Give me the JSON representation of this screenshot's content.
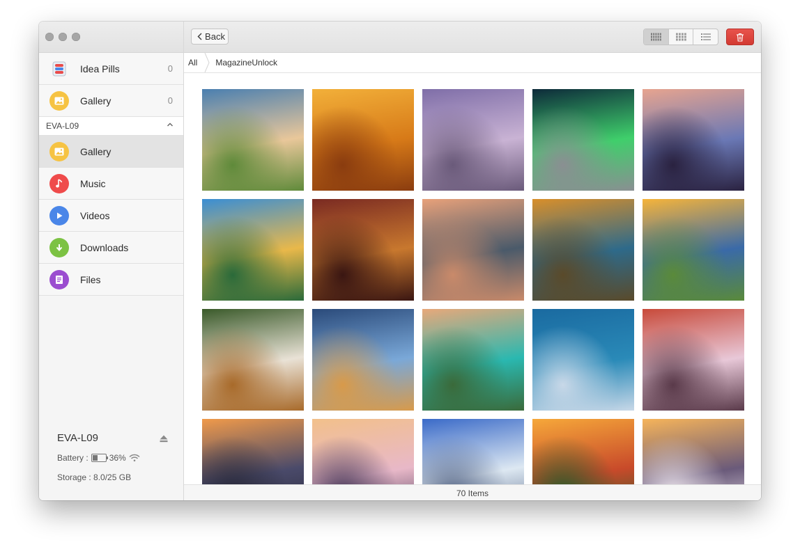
{
  "window": {
    "traffic_lights": [
      "close",
      "minimize",
      "zoom"
    ]
  },
  "sidebar": {
    "top_items": [
      {
        "label": "Idea Pills",
        "count": "0",
        "icon": "idea-pills-icon",
        "color": "#4a86e8"
      },
      {
        "label": "Gallery",
        "count": "0",
        "icon": "gallery-icon",
        "color": "#f6c343"
      }
    ],
    "device_header": "EVA-L09",
    "device_items": [
      {
        "label": "Gallery",
        "icon": "gallery-icon",
        "color": "#f6c343",
        "selected": true
      },
      {
        "label": "Music",
        "icon": "music-icon",
        "color": "#ef4b4b"
      },
      {
        "label": "Videos",
        "icon": "play-icon",
        "color": "#4a86e8"
      },
      {
        "label": "Downloads",
        "icon": "download-icon",
        "color": "#7cc243"
      },
      {
        "label": "Files",
        "icon": "file-icon",
        "color": "#9b4dd0"
      }
    ],
    "device_info": {
      "name": "EVA-L09",
      "battery_label": "Battery :",
      "battery_percent": "36%",
      "battery_level": 0.36,
      "storage": "Storage : 8.0/25 GB"
    }
  },
  "toolbar": {
    "back_label": "Back",
    "view_modes": [
      "large-grid",
      "medium-grid",
      "list"
    ],
    "active_view": "large-grid",
    "delete_color": "#e0453e"
  },
  "breadcrumb": {
    "items": [
      "All",
      "MagazineUnlock"
    ]
  },
  "gallery": {
    "thumbnails": [
      {
        "name": "coast-beach",
        "colors": [
          "#4a7fb0",
          "#e9c79a",
          "#5f8a3a"
        ]
      },
      {
        "name": "desert-dune",
        "colors": [
          "#f2b03a",
          "#d77a18",
          "#8a3c0f"
        ]
      },
      {
        "name": "misty-rocks",
        "colors": [
          "#7f6ea8",
          "#c9b3d4",
          "#6a5a7a"
        ]
      },
      {
        "name": "aurora-mountain",
        "colors": [
          "#0d2a3a",
          "#3fcf6b",
          "#8a8f92"
        ]
      },
      {
        "name": "bridge-sunset",
        "colors": [
          "#e7a48f",
          "#6a78b5",
          "#2a2240"
        ]
      },
      {
        "name": "autumn-lake",
        "colors": [
          "#3a8ed4",
          "#e9b84a",
          "#2a6a3a"
        ]
      },
      {
        "name": "cathedral-ceiling",
        "colors": [
          "#7a2a22",
          "#c8782e",
          "#3a1612"
        ]
      },
      {
        "name": "lake-church",
        "colors": [
          "#e8a17a",
          "#4a5a6a",
          "#c98a6a"
        ]
      },
      {
        "name": "autumn-hills",
        "colors": [
          "#d98f2a",
          "#2e6a8a",
          "#5a4a2a"
        ]
      },
      {
        "name": "rice-terraces",
        "colors": [
          "#f6b43a",
          "#3a6aa8",
          "#5a8a3a"
        ]
      },
      {
        "name": "forest-stream",
        "colors": [
          "#3a5a2a",
          "#e9e2d6",
          "#a86a2a"
        ]
      },
      {
        "name": "city-river",
        "colors": [
          "#2a4a7a",
          "#7aa8d8",
          "#d89a4a"
        ]
      },
      {
        "name": "sea-cove",
        "colors": [
          "#e8a87a",
          "#2ab8b0",
          "#3a6a3a"
        ]
      },
      {
        "name": "harbor-city",
        "colors": [
          "#1a6aa0",
          "#2a8ab8",
          "#c8d8e8"
        ]
      },
      {
        "name": "rocky-shore",
        "colors": [
          "#c84a3a",
          "#e8c8d8",
          "#5a3a4a"
        ]
      },
      {
        "name": "volcano-dawn",
        "colors": [
          "#f09a4a",
          "#4a4a6a",
          "#2a2a3a"
        ]
      },
      {
        "name": "snow-road",
        "colors": [
          "#f2c08a",
          "#e8b8c8",
          "#4a3a5a"
        ]
      },
      {
        "name": "winter-town",
        "colors": [
          "#3a6ac8",
          "#dde8f2",
          "#5a6a8a"
        ]
      },
      {
        "name": "cottage-sunset",
        "colors": [
          "#f6a83a",
          "#c84a2a",
          "#2a5a2a"
        ]
      },
      {
        "name": "ocean-sunset",
        "colors": [
          "#f6b45a",
          "#6a5a7a",
          "#e8e0e8"
        ]
      }
    ]
  },
  "status": {
    "items_count": "70 Items"
  }
}
